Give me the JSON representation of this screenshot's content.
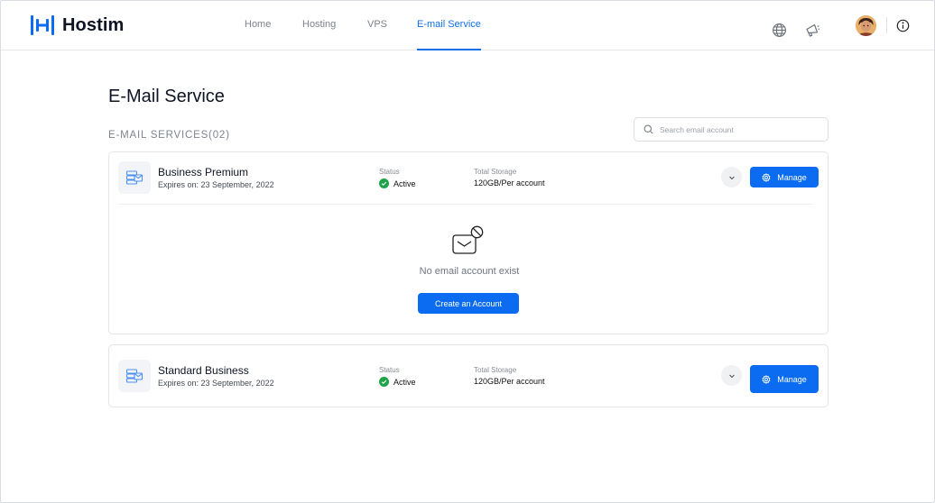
{
  "brand": {
    "name": "Hostim"
  },
  "nav": {
    "items": [
      {
        "label": "Home"
      },
      {
        "label": "Hosting"
      },
      {
        "label": "VPS"
      },
      {
        "label": "E-mail Service"
      }
    ],
    "active": "E-mail Service"
  },
  "header_icons": [
    "globe-icon",
    "megaphone-icon",
    "avatar",
    "info-icon"
  ],
  "page": {
    "title": "E-Mail Service",
    "section_label": "E-MAIL SERVICES(02)",
    "search": {
      "placeholder": "Search email account",
      "value": ""
    }
  },
  "services": [
    {
      "name": "Business Premium",
      "expiry": "Expires on: 23 September, 2022",
      "status_label": "Status",
      "status": "Active",
      "storage_label": "Total Storage",
      "storage": "120GB/Per account",
      "manage_label": "Manage",
      "expanded": true,
      "empty_state": {
        "message": "No email account exist",
        "button_label": "Create an Account"
      }
    },
    {
      "name": "Standard Business",
      "expiry": "Expires on: 23 September, 2022",
      "status_label": "Status",
      "status": "Active",
      "storage_label": "Total Storage",
      "storage": "120GB/Per account",
      "manage_label": "Manage",
      "expanded": false
    }
  ],
  "colors": {
    "accent": "#0b6cf2",
    "nav_active": "#1170e8",
    "status_active": "#1ea34a",
    "text_primary": "#0f1424",
    "text_muted": "#7e848e"
  }
}
